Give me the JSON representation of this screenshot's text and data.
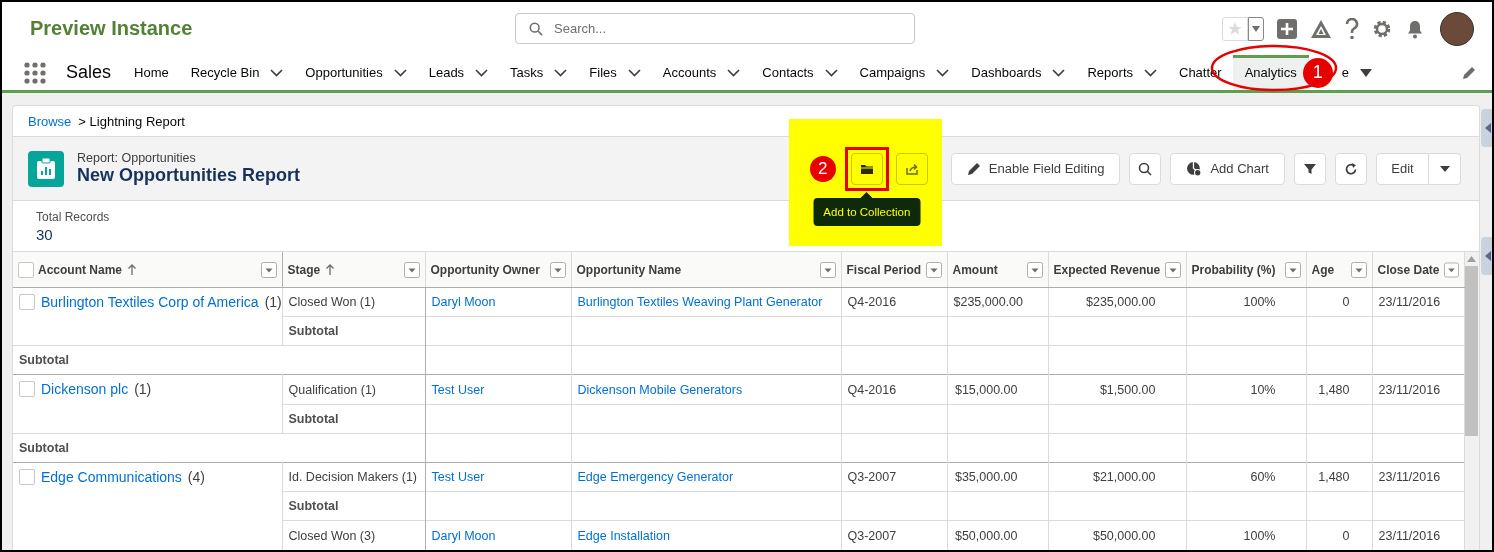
{
  "header": {
    "title": "Preview Instance",
    "search": {
      "placeholder": "Search..."
    }
  },
  "nav": {
    "app_name": "Sales",
    "tabs": [
      {
        "label": "Home",
        "kind": "plain",
        "selected": false
      },
      {
        "label": "Recycle Bin",
        "kind": "menu",
        "selected": false
      },
      {
        "label": "Opportunities",
        "kind": "menu",
        "selected": false
      },
      {
        "label": "Leads",
        "kind": "menu",
        "selected": false
      },
      {
        "label": "Tasks",
        "kind": "menu",
        "selected": false
      },
      {
        "label": "Files",
        "kind": "menu",
        "selected": false
      },
      {
        "label": "Accounts",
        "kind": "menu",
        "selected": false
      },
      {
        "label": "Contacts",
        "kind": "menu",
        "selected": false
      },
      {
        "label": "Campaigns",
        "kind": "menu",
        "selected": false
      },
      {
        "label": "Dashboards",
        "kind": "menu",
        "selected": false
      },
      {
        "label": "Reports",
        "kind": "menu",
        "selected": false
      },
      {
        "label": "Chatter",
        "kind": "plain",
        "selected": false
      },
      {
        "label": "Analytics",
        "kind": "plain",
        "selected": true
      },
      {
        "label": "e",
        "kind": "overflow",
        "selected": false
      }
    ]
  },
  "breadcrumb": {
    "link": "Browse",
    "current": "> Lightning Report"
  },
  "report": {
    "type_label": "Report: Opportunities",
    "title": "New Opportunities Report",
    "tooltip": "Add to Collection",
    "field_editing": "Enable Field Editing",
    "add_chart": "Add Chart",
    "edit": "Edit",
    "total_label": "Total Records",
    "total_value": "30"
  },
  "table": {
    "select_all_checked": false,
    "columns": [
      {
        "label": "Account Name",
        "sorted": true
      },
      {
        "label": "Stage",
        "sorted": true
      },
      {
        "label": "Opportunity Owner",
        "sorted": false
      },
      {
        "label": "Opportunity Name",
        "sorted": false
      },
      {
        "label": "Fiscal Period",
        "sorted": false
      },
      {
        "label": "Amount",
        "sorted": false
      },
      {
        "label": "Expected Revenue",
        "sorted": false
      },
      {
        "label": "Probability (%)",
        "sorted": false
      },
      {
        "label": "Age",
        "sorted": false
      },
      {
        "label": "Close Date",
        "sorted": false
      }
    ],
    "groups": [
      {
        "account": "Burlington Textiles Corp of America",
        "count": "(1)",
        "checked": false,
        "subtotal": "Subtotal",
        "stages": [
          {
            "stage": "Closed Won (1)",
            "subtotal": "Subtotal",
            "records": [
              {
                "owner": "Daryl Moon",
                "opportunity": "Burlington Textiles Weaving Plant Generator",
                "fiscal_period": "Q4-2016",
                "amount": "$235,000.00",
                "expected_revenue": "$235,000.00",
                "probability": "100%",
                "age": "0",
                "close_date": "23/11/2016"
              }
            ]
          }
        ]
      },
      {
        "account": "Dickenson plc",
        "count": "(1)",
        "checked": false,
        "subtotal": "Subtotal",
        "stages": [
          {
            "stage": "Qualification (1)",
            "subtotal": "Subtotal",
            "records": [
              {
                "owner": "Test User",
                "opportunity": "Dickenson Mobile Generators",
                "fiscal_period": "Q4-2016",
                "amount": "$15,000.00",
                "expected_revenue": "$1,500.00",
                "probability": "10%",
                "age": "1,480",
                "close_date": "23/11/2016"
              }
            ]
          }
        ]
      },
      {
        "account": "Edge Communications",
        "count": "(4)",
        "checked": false,
        "stages": [
          {
            "stage": "Id. Decision Makers (1)",
            "subtotal": "Subtotal",
            "records": [
              {
                "owner": "Test User",
                "opportunity": "Edge Emergency Generator",
                "fiscal_period": "Q3-2007",
                "amount": "$35,000.00",
                "expected_revenue": "$21,000.00",
                "probability": "60%",
                "age": "1,480",
                "close_date": "23/11/2016"
              }
            ]
          },
          {
            "stage": "Closed Won (3)",
            "records": [
              {
                "owner": "Daryl Moon",
                "opportunity": "Edge Installation",
                "fiscal_period": "Q3-2007",
                "amount": "$50,000.00",
                "expected_revenue": "$50,000.00",
                "probability": "100%",
                "age": "0",
                "close_date": "23/11/2016"
              }
            ]
          }
        ]
      }
    ]
  },
  "annotations": [
    {
      "label": "1"
    },
    {
      "label": "2"
    }
  ]
}
